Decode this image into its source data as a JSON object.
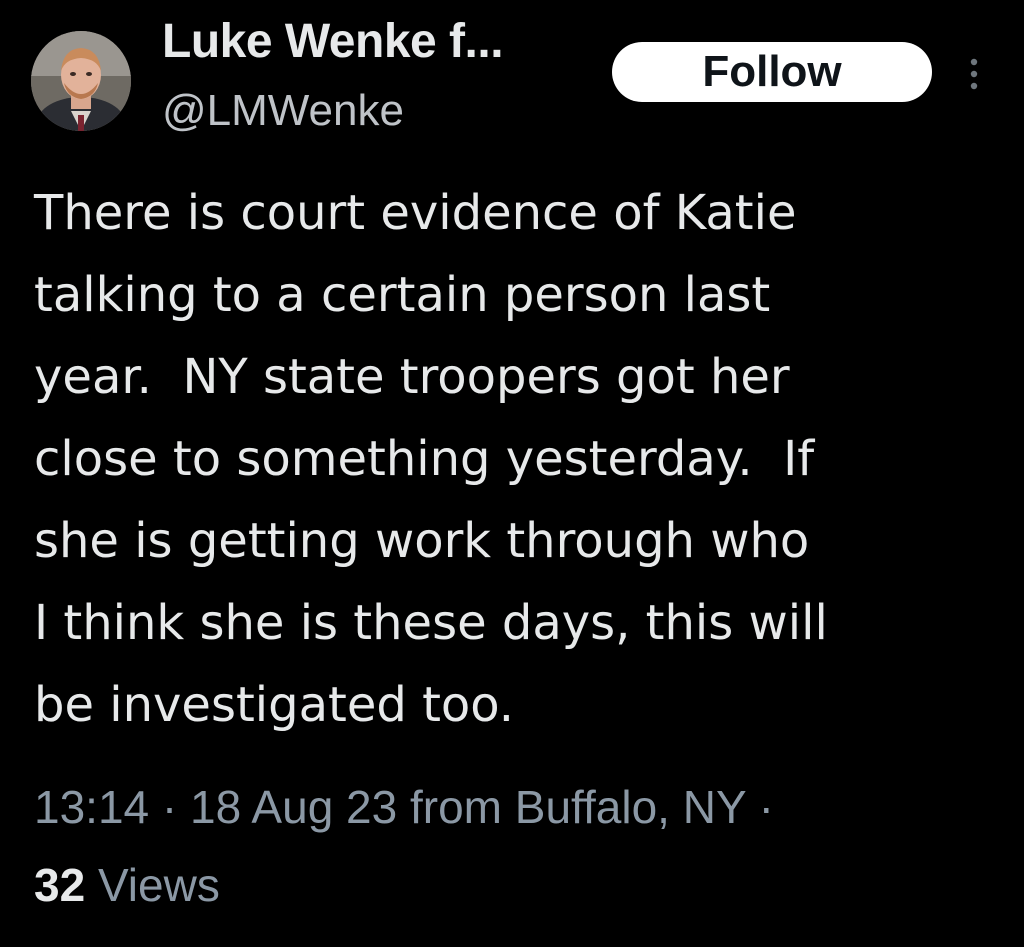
{
  "author": {
    "name": "Luke Wenke f...",
    "handle": "@LMWenke"
  },
  "follow_button": {
    "label": "Follow"
  },
  "more_menu": {
    "icon": "vertical-ellipsis-icon"
  },
  "tweet": {
    "lines": [
      "There is court evidence of Katie",
      "talking to a certain person last",
      "year.  NY state troopers got her",
      "close to something yesterday.  If",
      "she is getting work through who",
      "I think she is these days, this will",
      "be investigated too."
    ]
  },
  "meta": {
    "time": "13:14",
    "separator": " · ",
    "date": "18 Aug 23",
    "location": " from Buffalo, NY",
    "trailing_separator": " ·"
  },
  "stats": {
    "views_count": "32",
    "views_label": " Views"
  },
  "colors": {
    "background": "#000000",
    "primary_text": "#e7e9ea",
    "secondary_text": "#8b98a5",
    "follow_bg": "#ffffff",
    "follow_text": "#0f1419"
  }
}
